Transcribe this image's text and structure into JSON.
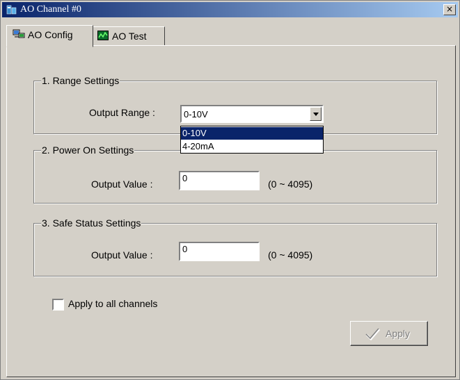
{
  "window": {
    "title": "AO Channel #0",
    "close_glyph": "×"
  },
  "tabs": [
    {
      "label": "AO Config",
      "icon": "network-config-icon",
      "active": true
    },
    {
      "label": "AO Test",
      "icon": "waveform-icon",
      "active": false
    }
  ],
  "range_settings": {
    "title": "1. Range Settings",
    "output_range_label": "Output Range :",
    "output_range_value": "0-10V",
    "options": [
      "0-10V",
      "4-20mA"
    ]
  },
  "power_on_settings": {
    "title": "2. Power On Settings",
    "output_value_label": "Output Value :",
    "output_value": "0",
    "range_hint": "(0 ~ 4095)"
  },
  "safe_status_settings": {
    "title": "3. Safe Status Settings",
    "output_value_label": "Output Value :",
    "output_value": "0",
    "range_hint": "(0 ~ 4095)"
  },
  "apply_all": {
    "label": "Apply to all channels",
    "checked": false
  },
  "apply_button": {
    "label": "Apply",
    "icon": "checkmark-icon",
    "enabled": false
  },
  "colors": {
    "titlebar_start": "#0a246a",
    "titlebar_end": "#a6caf0",
    "selection": "#0a246a",
    "face": "#d4d0c8"
  }
}
